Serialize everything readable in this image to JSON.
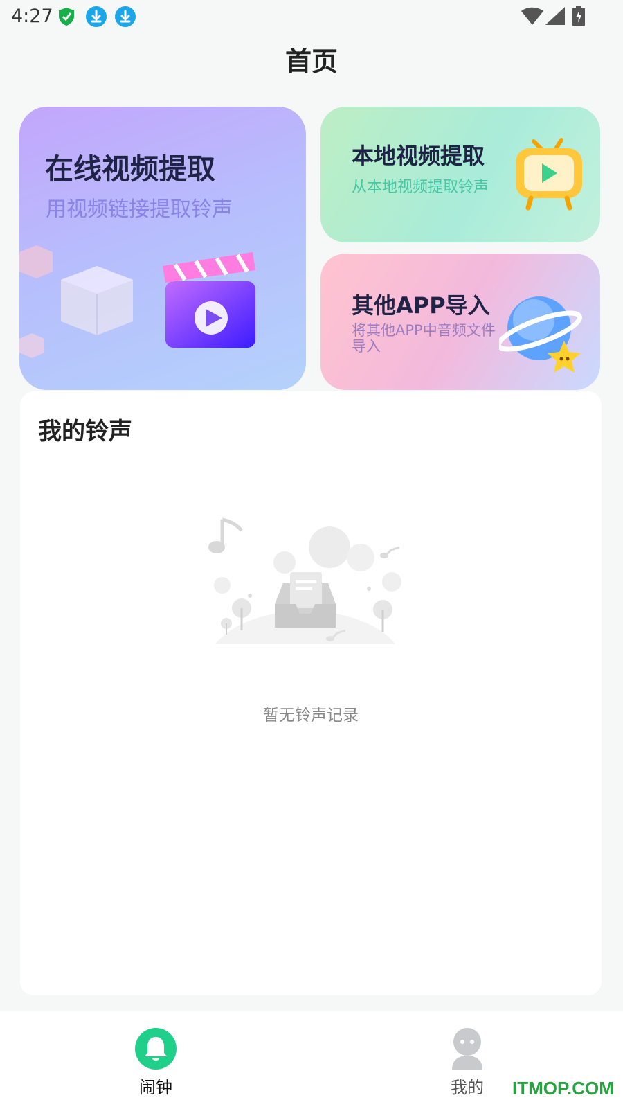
{
  "status_bar": {
    "time": "4:27",
    "icons": [
      "shield-icon",
      "download-icon",
      "download-icon",
      "wifi-icon",
      "signal-icon",
      "battery-charging-icon"
    ]
  },
  "page": {
    "title": "首页"
  },
  "cards": {
    "online": {
      "title": "在线视频提取",
      "subtitle": "用视频链接提取铃声",
      "icon": "clapperboard-icon"
    },
    "local": {
      "title": "本地视频提取",
      "subtitle": "从本地视频提取铃声",
      "icon": "tv-play-icon"
    },
    "other": {
      "title": "其他APP导入",
      "subtitle": "将其他APP中音频文件导入",
      "icon": "planet-star-icon"
    }
  },
  "ringtones": {
    "title": "我的铃声",
    "empty_text": "暂无铃声记录"
  },
  "bottom_nav": {
    "items": [
      {
        "label": "闹钟",
        "icon": "bell-icon",
        "active": true
      },
      {
        "label": "我的",
        "icon": "person-icon",
        "active": false
      }
    ]
  },
  "watermark": "ITMOP.COM",
  "colors": {
    "accent": "#1fcf8a",
    "background": "#f6f7f7",
    "inactive_icon": "#c8cacd"
  }
}
